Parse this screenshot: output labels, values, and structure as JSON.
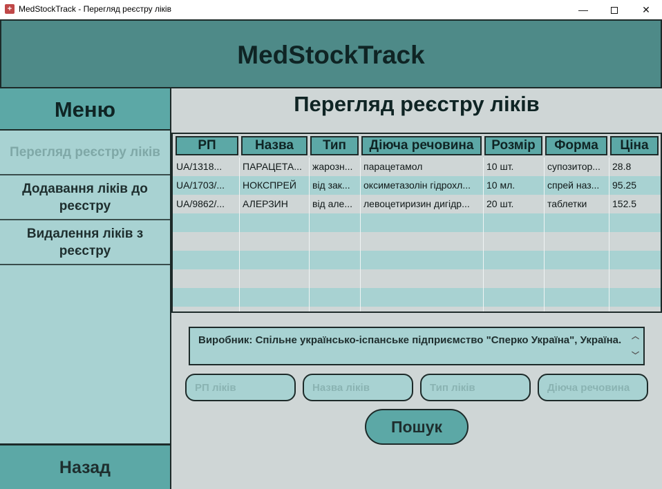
{
  "window": {
    "title": "MedStockTrack - Перегляд реєстру ліків",
    "min_symbol": "—",
    "close_symbol": "✕"
  },
  "header": {
    "app_title": "MedStockTrack"
  },
  "sidebar": {
    "menu_title": "Меню",
    "items": [
      {
        "label": "Перегляд реєстру ліків",
        "active": true
      },
      {
        "label": "Додавання ліків до реєстру",
        "active": false
      },
      {
        "label": "Видалення ліків з реєстру",
        "active": false
      }
    ],
    "back_label": "Назад"
  },
  "main": {
    "page_title": "Перегляд реєстру ліків",
    "table": {
      "columns": [
        "РП",
        "Назва",
        "Тип",
        "Діюча речовина",
        "Розмір",
        "Форма",
        "Ціна"
      ],
      "rows": [
        [
          "UA/1318...",
          "ПАРАЦЕТА...",
          "жарозн...",
          "парацетамол",
          "10 шт.",
          "супозитор...",
          "28.8"
        ],
        [
          "UA/1703/...",
          "НОКСПРЕЙ",
          "від зак...",
          "оксиметазолін гідрохл...",
          "10 мл.",
          "спрей наз...",
          "95.25"
        ],
        [
          "UA/9862/...",
          "АЛЕРЗИН",
          "від але...",
          "левоцетиризин дигідр...",
          "20 шт.",
          "таблетки",
          "152.5"
        ]
      ]
    },
    "description": "Виробник: Спільне українсько-іспанське підприємство \"Сперко Україна\", Україна.",
    "search": {
      "rp_placeholder": "РП ліків",
      "name_placeholder": "Назва ліків",
      "type_placeholder": "Тип ліків",
      "substance_placeholder": "Діюча речовина",
      "button_label": "Пошук"
    }
  },
  "colors": {
    "header_bg": "#4e8a88",
    "accent": "#5ca8a6",
    "light": "#a8d2d2",
    "main_bg": "#cfd6d6",
    "text_dark": "#0f2424"
  }
}
